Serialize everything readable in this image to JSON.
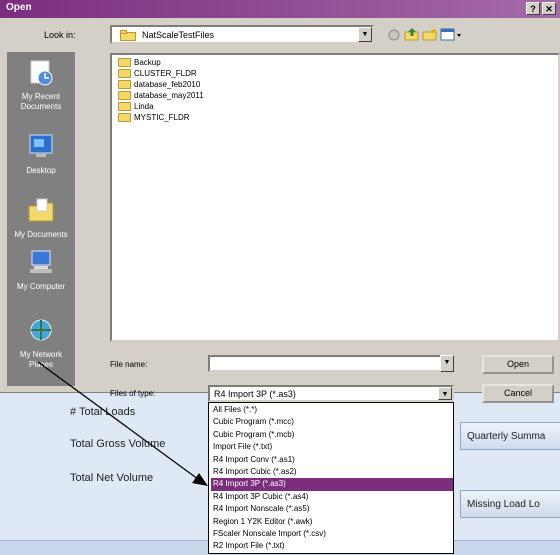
{
  "dialog": {
    "title": "Open",
    "help_button": "?",
    "close_button": "✕",
    "look_in_label": "Look in:",
    "look_in_value": "NatScaleTestFiles",
    "places": [
      {
        "label": "My Recent Documents"
      },
      {
        "label": "Desktop"
      },
      {
        "label": "My Documents"
      },
      {
        "label": "My Computer"
      },
      {
        "label": "My Network Places"
      }
    ],
    "folders": [
      "Backup",
      "CLUSTER_FLDR",
      "database_feb2010",
      "database_may2011",
      "Linda",
      "MYSTIC_FLDR"
    ],
    "file_name_label": "File name:",
    "file_name_value": "",
    "files_of_type_label": "Files of type:",
    "files_of_type_value": "R4 Import 3P (*.as3)",
    "open_button": "Open",
    "cancel_button": "Cancel",
    "file_types": [
      "All Files (*.*)",
      "Cubic Program (*.mcc)",
      "Cubic Program (*.mcb)",
      "Import File (*.txt)",
      "R4 Import Conv (*.as1)",
      "R4 Import Cubic (*.as2)",
      "R4 Import 3P (*.as3)",
      "R4 Import 3P Cubic (*.as4)",
      "R4 Import Nonscale (*.as5)",
      "Region 1 Y2K Editor (*.awk)",
      "FScaler Nonscale Import (*.csv)",
      "R2 Import File (*.txt)"
    ],
    "selected_type_index": 6
  },
  "background": {
    "total_loads_label": "# Total Loads",
    "total_gross_label": "Total Gross Volume",
    "total_net_label": "Total Net Volume",
    "quarterly_button": "Quarterly Summa",
    "missing_button": "Missing Load Lo"
  },
  "colors": {
    "titlebar": "#7b2e7e",
    "selection": "#7b2e7e",
    "dialog_bg": "#d4d0c8"
  }
}
